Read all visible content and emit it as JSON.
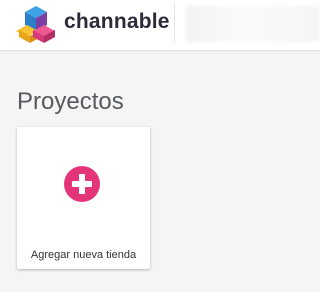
{
  "header": {
    "brand_name": "channable",
    "logo_icon": "channable-logo-icon"
  },
  "main": {
    "page_title": "Proyectos",
    "add_card": {
      "label": "Agregar nueva tienda",
      "icon": "plus-circle-icon"
    }
  },
  "colors": {
    "accent_pink": "#e4357b",
    "background": "#f5f5f5",
    "logo_blue": "#2f8fd8",
    "logo_yellow": "#f6c332",
    "logo_pink": "#e23b7f",
    "logo_purple": "#7b3fa6"
  }
}
